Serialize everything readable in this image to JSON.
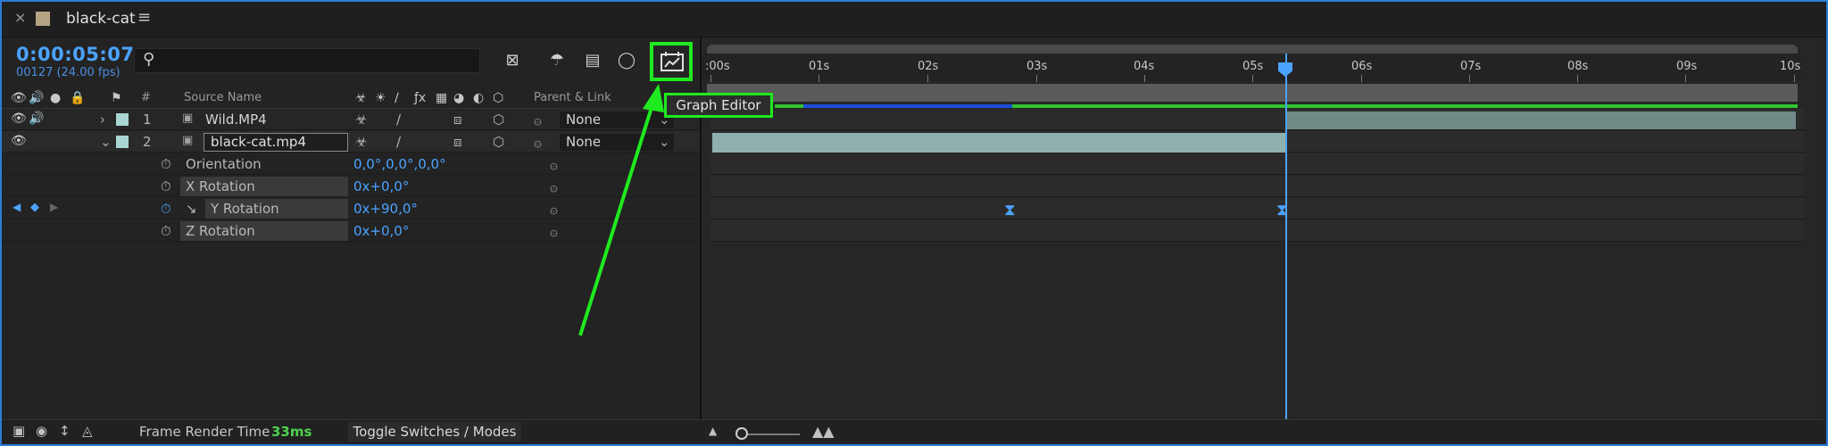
{
  "tab": {
    "title": "black-cat",
    "close": "×",
    "menu": "≡"
  },
  "header": {
    "timecode": "0:00:05:07",
    "frames": "00127 (24.00 fps)",
    "search_placeholder": ""
  },
  "columns": {
    "number": "#",
    "source_name": "Source Name",
    "parent_link": "Parent & Link"
  },
  "layers": [
    {
      "number": "1",
      "name": "Wild.MP4",
      "parent": "None"
    },
    {
      "number": "2",
      "name": "black-cat.mp4",
      "parent": "None"
    }
  ],
  "properties": [
    {
      "name": "Orientation",
      "value": "0,0°,0,0°,0,0°"
    },
    {
      "name": "X Rotation",
      "value": "0x+0,0°"
    },
    {
      "name": "Y Rotation",
      "value": "0x+90,0°"
    },
    {
      "name": "Z Rotation",
      "value": "0x+0,0°"
    }
  ],
  "ruler": {
    "labels": [
      ":00s",
      "01s",
      "02s",
      "03s",
      "04s",
      "05s",
      "06s",
      "07s",
      "08s",
      "09s",
      "10s"
    ]
  },
  "tooltip": "Graph Editor",
  "bottom": {
    "frame_render_label": "Frame Render Time",
    "frame_render_value": "33ms",
    "toggle_label": "Toggle Switches / Modes"
  },
  "colors": {
    "accent": "#4ba3ff",
    "highlight": "#1fea1f",
    "layer_label": "#a9d6d2"
  }
}
